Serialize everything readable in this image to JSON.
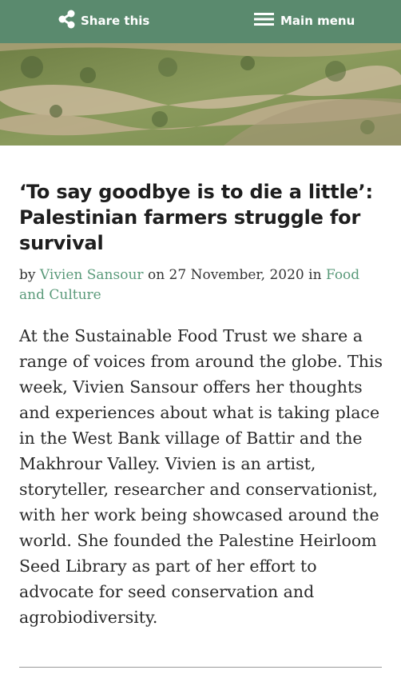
{
  "header": {
    "share_label": "Share this",
    "menu_label": "Main menu",
    "background_color": "#5a8a6e",
    "share_icon": "share-icon",
    "menu_icon": "hamburger-menu-icon"
  },
  "article": {
    "title": "‘To say goodbye is to die a little’: Palestinian farmers struggle for survival",
    "byline": {
      "by": "by",
      "author": "Vivien Sansour",
      "on": "on",
      "date": "27 November, 2020",
      "in": "in",
      "category": "Food and Culture"
    },
    "intro": "At the Sustainable Food Trust we share a range of voices from around the globe. This week, Vivien Sansour offers her thoughts and experiences about what is taking place in the West Bank village of Battir and the Makhrour Valley. Vivien is an artist, storyteller, researcher and conservationist, with her work being showcased around the world. She founded the Palestine Heirloom Seed Library as part of her effort to advocate for seed conservation and agrobiodiversity.",
    "link_color": "#5a9a7a"
  }
}
